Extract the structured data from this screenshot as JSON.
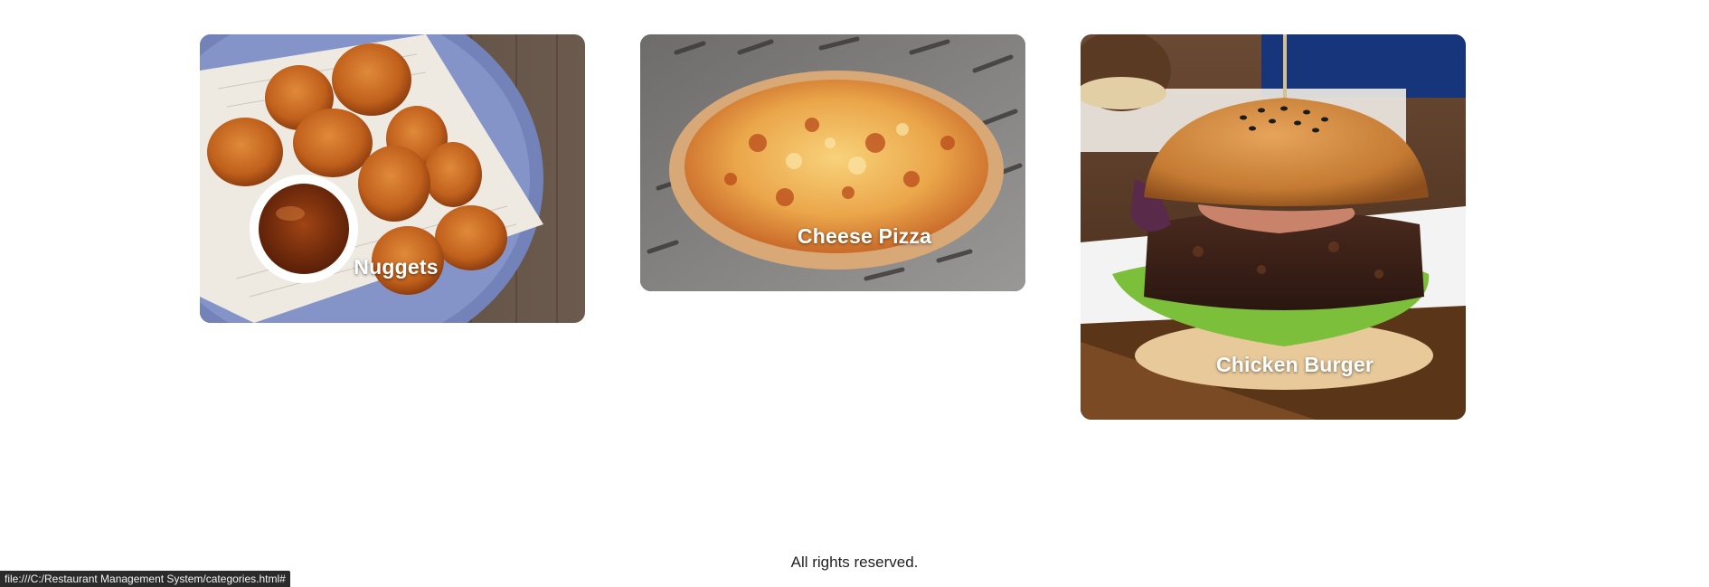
{
  "categories": [
    {
      "label": "Nuggets"
    },
    {
      "label": "Cheese Pizza"
    },
    {
      "label": "Chicken Burger"
    }
  ],
  "footer": {
    "text": "All rights reserved."
  },
  "status_bar": {
    "url": "file:///C:/Restaurant Management System/categories.html#"
  }
}
